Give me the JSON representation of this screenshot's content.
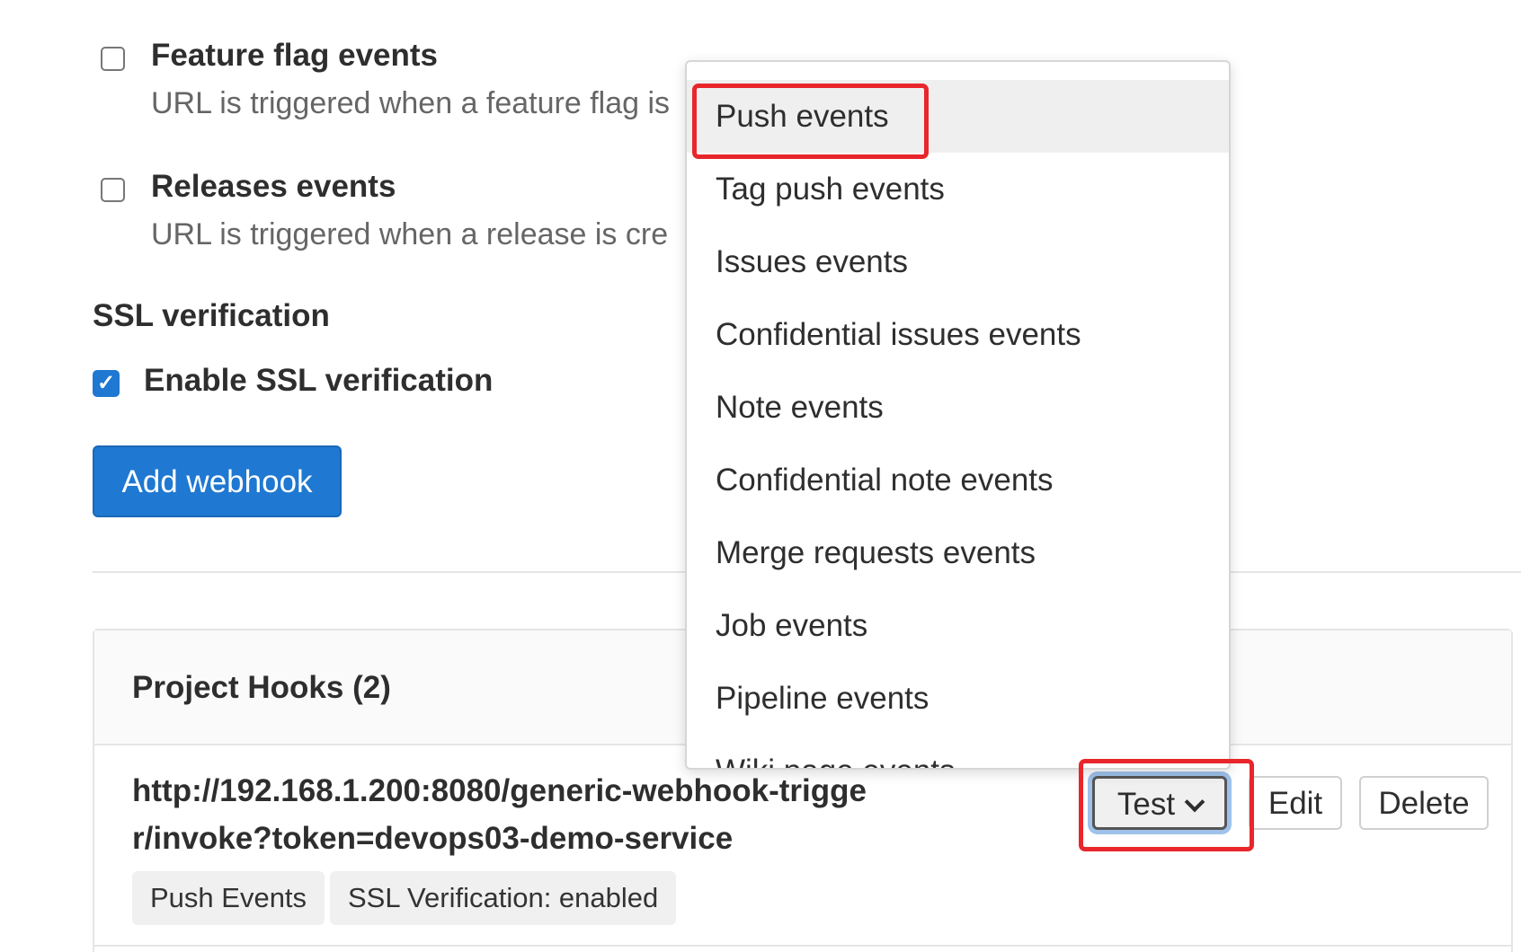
{
  "events": [
    {
      "title": "Feature flag events",
      "description": "URL is triggered when a feature flag is",
      "checked": false
    },
    {
      "title": "Releases events",
      "description": "URL is triggered when a release is cre",
      "checked": false
    }
  ],
  "ssl": {
    "heading": "SSL verification",
    "label": "Enable SSL verification",
    "checked": true,
    "check_glyph": "✓"
  },
  "add_webhook_label": "Add webhook",
  "hooks": {
    "title": "Project Hooks (2)",
    "url": "http://192.168.1.200:8080/generic-webhook-trigger/invoke?token=devops03-demo-service",
    "badges": [
      "Push Events",
      "SSL Verification: enabled"
    ],
    "buttons": {
      "test": "Test",
      "edit": "Edit",
      "delete": "Delete"
    }
  },
  "dropdown": {
    "items": [
      "Push events",
      "Tag push events",
      "Issues events",
      "Confidential issues events",
      "Note events",
      "Confidential note events",
      "Merge requests events",
      "Job events",
      "Pipeline events",
      "Wiki page events"
    ],
    "active_index": 0
  },
  "colors": {
    "primary": "#1f78d1",
    "annotation": "#e8262b",
    "focus_ring": "#9ec2ea"
  }
}
